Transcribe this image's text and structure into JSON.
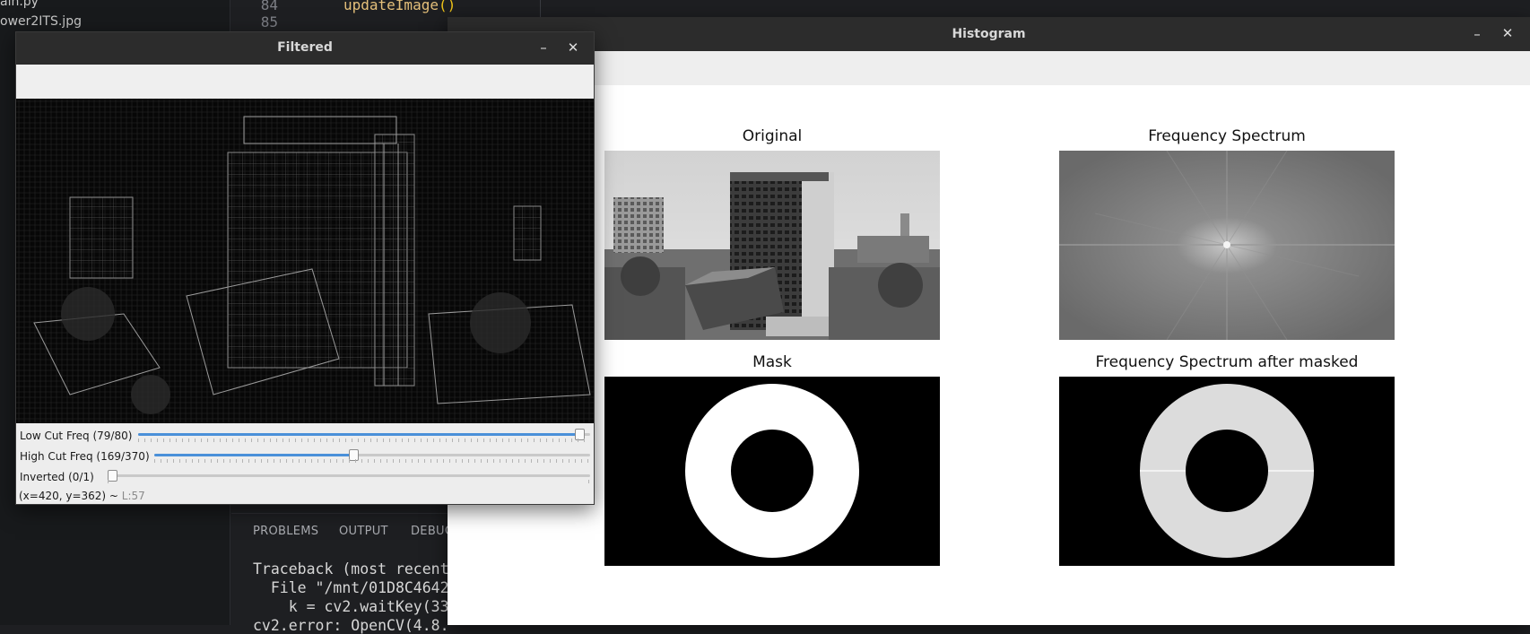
{
  "editor": {
    "explorer_files": [
      "ain.py",
      "ower2ITS.jpg"
    ],
    "code_lines": [
      {
        "number": "84",
        "text": "updateImage",
        "paren": "()"
      },
      {
        "number": "85",
        "text": "",
        "paren": ""
      }
    ],
    "panel_tabs": [
      "PROBLEMS",
      "OUTPUT",
      "DEBUG"
    ],
    "terminal_lines": [
      "Traceback (most recent",
      "  File \"/mnt/01D8C4642",
      "    k = cv2.waitKey(33",
      "cv2.error: OpenCV(4.8."
    ]
  },
  "histogram_window": {
    "title": "Histogram",
    "minimize_label": "–",
    "close_label": "✕",
    "subplots": [
      {
        "title": "Original"
      },
      {
        "title": "Frequency Spectrum"
      },
      {
        "title": "Mask"
      },
      {
        "title": "Frequency Spectrum after masked"
      }
    ]
  },
  "filtered_window": {
    "title": "Filtered",
    "minimize_label": "–",
    "close_label": "✕",
    "trackbars": [
      {
        "label": "Low Cut Freq (79/80)",
        "value": 79,
        "max": 80
      },
      {
        "label": "High Cut Freq (169/370)",
        "value": 169,
        "max": 370
      },
      {
        "label": "Inverted   (0/1)",
        "value": 0,
        "max": 1
      }
    ],
    "status": {
      "coords": "(x=420, y=362) ~ ",
      "level": "L:57"
    }
  },
  "icons": [
    "minimize-icon",
    "close-icon"
  ]
}
